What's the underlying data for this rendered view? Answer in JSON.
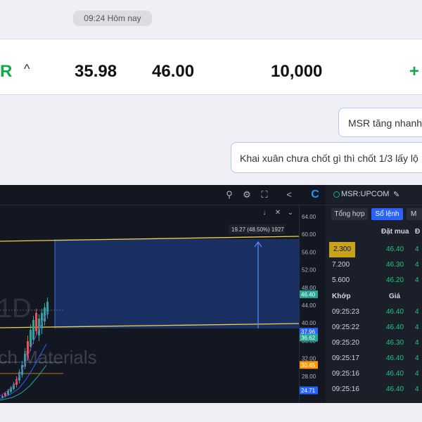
{
  "chat": {
    "time_label": "09:24 Hôm nay",
    "messages": [
      {
        "text": "MSR tăng nhanh"
      },
      {
        "text": "Khai xuân chưa chốt gì thì chốt 1/3 lấy lộ"
      }
    ]
  },
  "quote_row": {
    "symbol_fragment": "R",
    "caret": "^",
    "value_a": "35.98",
    "value_b": "46.00",
    "volume": "10,000",
    "change_fragment": "+"
  },
  "chart": {
    "watermark_interval": "1D",
    "watermark_name": "Tech Materials",
    "measure_label": "19.27 (48.50%) 1927",
    "price_ticks": [
      "64.00",
      "60.00",
      "56.00",
      "52.00",
      "48.00",
      "44.00",
      "40.00",
      "36.00",
      "32.00",
      "28.00"
    ],
    "price_tags": [
      {
        "label": "46.40",
        "color": "#26a69a"
      },
      {
        "label": "37.96",
        "color": "#2962ff"
      },
      {
        "label": "36.62",
        "color": "#26a69a"
      },
      {
        "label": "30.45",
        "color": "#ff9800"
      },
      {
        "label": "24.71",
        "color": "#2962ff"
      }
    ],
    "toolbar_icons": [
      "zoom-icon",
      "settings-icon",
      "fullscreen-icon",
      "share-icon",
      "refresh-icon"
    ],
    "mini_buttons": [
      "↓",
      "✕",
      "⌄"
    ]
  },
  "order_panel": {
    "symbol": "MSR:UPCOM",
    "tabs": [
      "Tổng hợp",
      "Sổ lệnh",
      "M"
    ],
    "book_headers": {
      "buy_price": "Đặt mua",
      "more": "Đ"
    },
    "book_rows": [
      {
        "volume": "2.300",
        "price": "46.40",
        "more": "4"
      },
      {
        "volume": "7.200",
        "price": "46.30",
        "more": "4"
      },
      {
        "volume": "5.600",
        "price": "46.20",
        "more": "4"
      }
    ],
    "match_headers": {
      "time": "Khớp",
      "price": "Giá"
    },
    "match_rows": [
      {
        "time": "09:25:23",
        "price": "46.40",
        "more": "4"
      },
      {
        "time": "09:25:22",
        "price": "46.40",
        "more": "4"
      },
      {
        "time": "09:25:20",
        "price": "46.30",
        "more": "4"
      },
      {
        "time": "09:25:17",
        "price": "46.40",
        "more": "4"
      },
      {
        "time": "09:25:16",
        "price": "46.40",
        "more": "4"
      },
      {
        "time": "09:25:16",
        "price": "46.40",
        "more": "4"
      }
    ]
  }
}
